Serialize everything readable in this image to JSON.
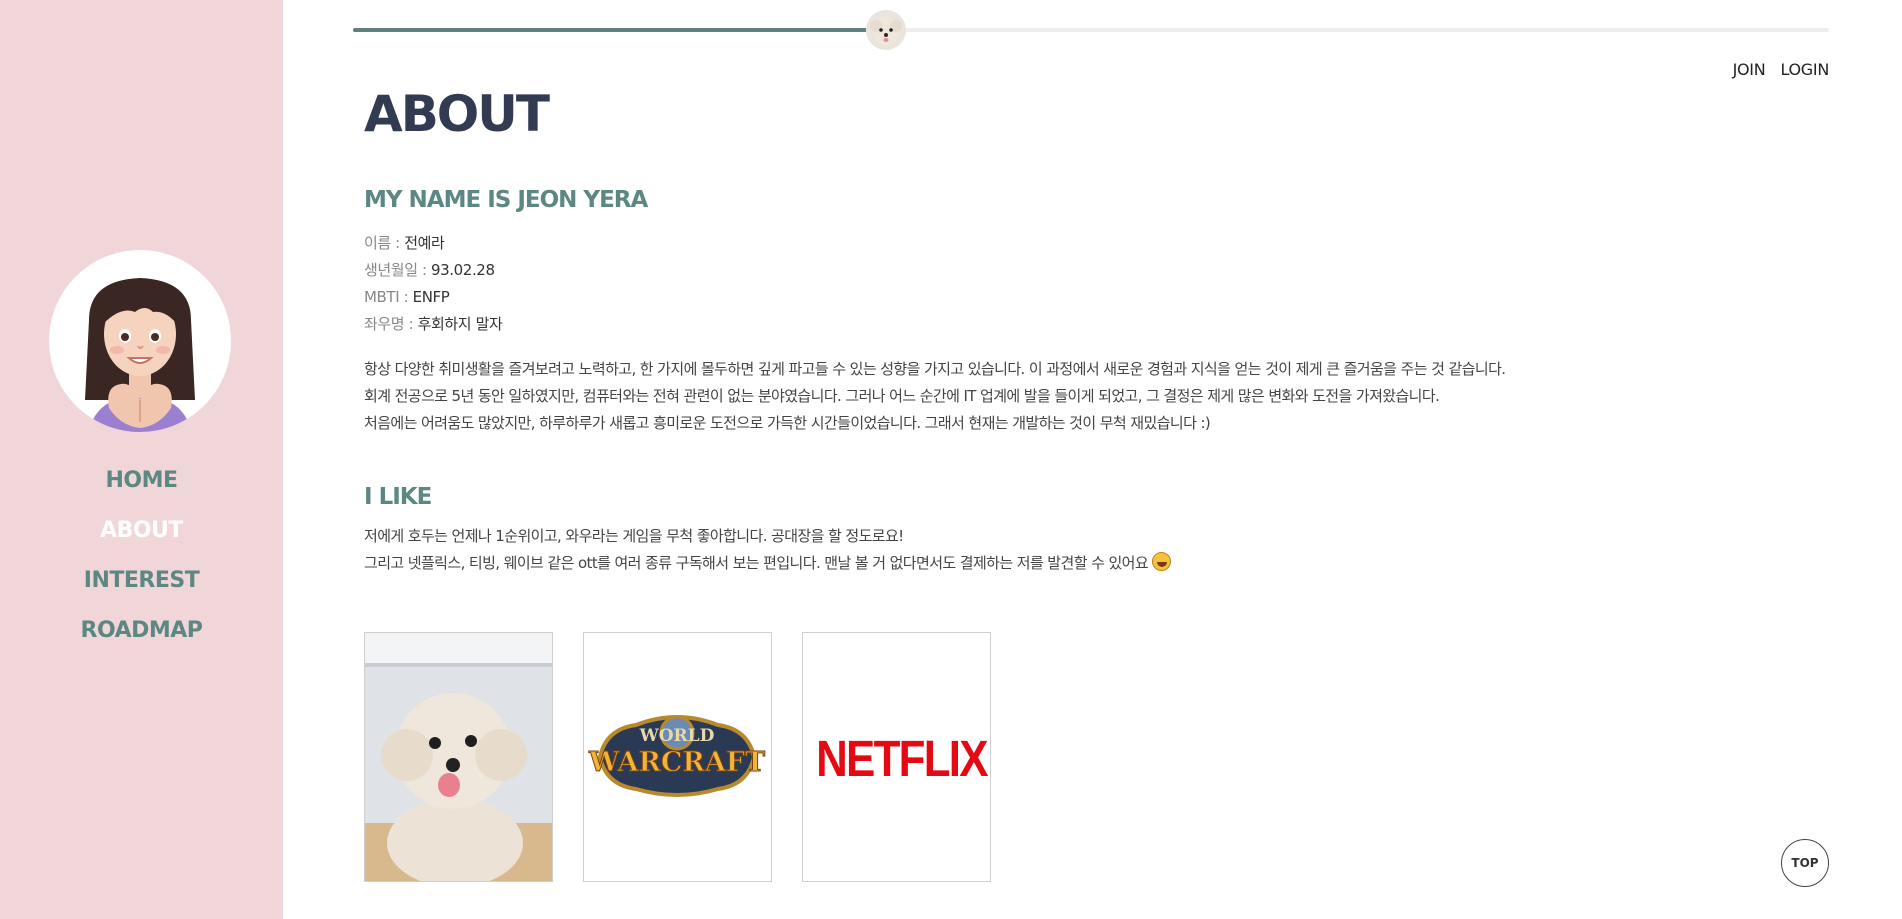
{
  "sidebar": {
    "avatar_alt": "",
    "nav": [
      {
        "label": "HOME",
        "active": false
      },
      {
        "label": "ABOUT",
        "active": true
      },
      {
        "label": "INTEREST",
        "active": false
      },
      {
        "label": "ROADMAP",
        "active": false
      }
    ]
  },
  "progress": {
    "value": 0.36,
    "track_color": "#eeeeee",
    "fill_color": "#5f807c"
  },
  "header": {
    "join_label": "JOIN",
    "login_label": "LOGIN"
  },
  "main": {
    "title": "ABOUT",
    "name_heading": "MY NAME IS JEON YERA",
    "info": [
      {
        "key": "이름 :",
        "value": "전예라"
      },
      {
        "key": "생년월일 :",
        "value": "93.02.28"
      },
      {
        "key": "MBTI :",
        "value": "ENFP"
      },
      {
        "key": "좌우명 :",
        "value": "후회하지 말자"
      }
    ],
    "intro": [
      "항상 다양한 취미생활을 즐겨보려고 노력하고, 한 가지에 몰두하면 깊게 파고들 수 있는 성향을 가지고 있습니다. 이 과정에서 새로운 경험과 지식을 얻는 것이 제게 큰 즐거움을 주는 것 같습니다.",
      "회계 전공으로 5년 동안 일하였지만, 컴퓨터와는 전혀 관련이 없는 분야였습니다. 그러나 어느 순간에 IT 업계에 발을 들이게 되었고, 그 결정은 제게 많은 변화와 도전을 가져왔습니다.",
      "처음에는 어려움도 많았지만, 하루하루가 새롭고 흥미로운 도전으로 가득한 시간들이었습니다. 그래서 현재는 개발하는 것이 무척 재밌습니다 :)"
    ],
    "like_heading": "I LIKE",
    "likes": [
      "저에게 호두는 언제나 1순위이고, 와우라는 게임을 무척 좋아합니다. 공대장을 할 정도로요!",
      "그리고 넷플릭스, 티빙, 웨이브 같은 ott를 여러 종류 구독해서 보는 편입니다. 맨날 볼 거 없다면서도 결제하는 저를 발견할 수 있어요"
    ],
    "cards": {
      "warcraft_top": "WORLD",
      "warcraft_bottom": "WARCRAFT",
      "netflix": "NETFLIX"
    }
  },
  "top_button": "TOP",
  "colors": {
    "sidebar_bg": "#f1d6d9",
    "accent": "#5d8782",
    "title": "#333b52",
    "netflix_red": "#e50914"
  }
}
